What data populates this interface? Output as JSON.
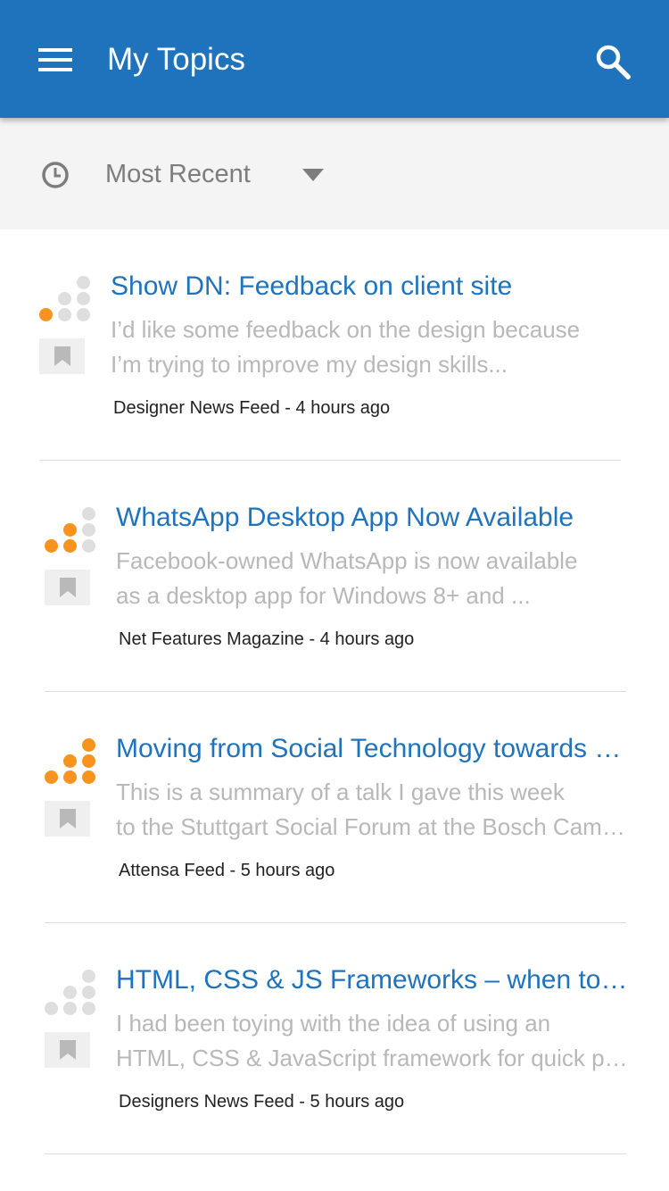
{
  "appbar": {
    "title": "My Topics",
    "menu_icon": "hamburger-menu-icon",
    "search_icon": "search-icon",
    "color": "#1f73bd"
  },
  "filter": {
    "icon": "clock-icon",
    "selected": "Most Recent"
  },
  "items": [
    {
      "title": "Show DN: Feedback on client site",
      "summary_line1": "I’d like some feedback on the design because",
      "summary_line2": "I’m trying to improve my design skills...",
      "source": "Designer News Feed",
      "separator": " - ",
      "time": "4 hours ago",
      "relevance_level": 1
    },
    {
      "title": "WhatsApp Desktop App Now Available",
      "summary_line1": "Facebook-owned WhatsApp is now available",
      "summary_line2": "as a desktop app for Windows 8+ and ...",
      "source": "Net Features Magazine",
      "separator": " - ",
      "time": "4 hours ago",
      "relevance_level": 3
    },
    {
      "title": "Moving from Social Technology towards Social Business",
      "summary_line1": "This is a summary of a talk I gave this week",
      "summary_line2": "to the Stuttgart Social Forum at the Bosch Campus",
      "source": "Attensa Feed",
      "separator": " - ",
      "time": "5 hours ago",
      "relevance_level": 6
    },
    {
      "title": "HTML, CSS & JS Frameworks – when to use them",
      "summary_line1": "I had been toying with the idea of using an",
      "summary_line2": "HTML, CSS & JavaScript framework for quick prototyping",
      "source": "Designers News Feed",
      "separator": " - ",
      "time": "5 hours ago",
      "relevance_level": 0
    }
  ],
  "colors": {
    "accent": "#1f73bd",
    "relevance_on": "#f7931e",
    "relevance_off": "#dedede"
  }
}
